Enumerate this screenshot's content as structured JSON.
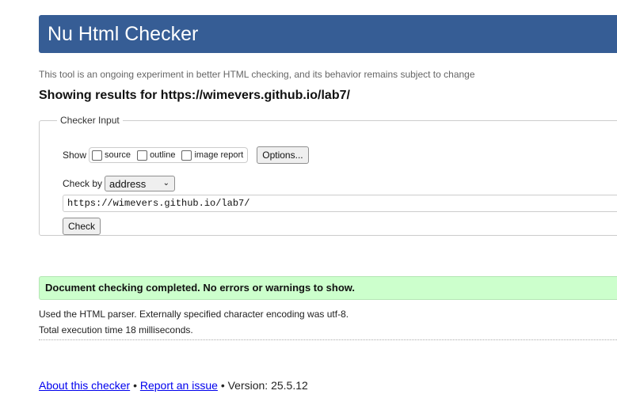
{
  "header": {
    "title": "Nu Html Checker",
    "color": "#365d95"
  },
  "tagline": "This tool is an ongoing experiment in better HTML checking, and its behavior remains subject to change",
  "showing": "Showing results for https://wimevers.github.io/lab7/",
  "checker_input": {
    "legend": "Checker Input",
    "show_label": "Show",
    "options": [
      {
        "label": "source",
        "checked": false
      },
      {
        "label": "outline",
        "checked": false
      },
      {
        "label": "image report",
        "checked": false
      }
    ],
    "options_button": "Options...",
    "check_by_label": "Check by",
    "check_by_value": "address",
    "url_value": "https://wimevers.github.io/lab7/",
    "check_button": "Check"
  },
  "result": {
    "success_message": "Document checking completed. No errors or warnings to show.",
    "success_color": "#ccffcc",
    "parser_info": "Used the HTML parser. Externally specified character encoding was utf-8.",
    "execution_time": "Total execution time 18 milliseconds."
  },
  "footer": {
    "about_link": "About this checker",
    "separator": "•",
    "report_link": "Report an issue",
    "version": "Version: 25.5.12"
  }
}
